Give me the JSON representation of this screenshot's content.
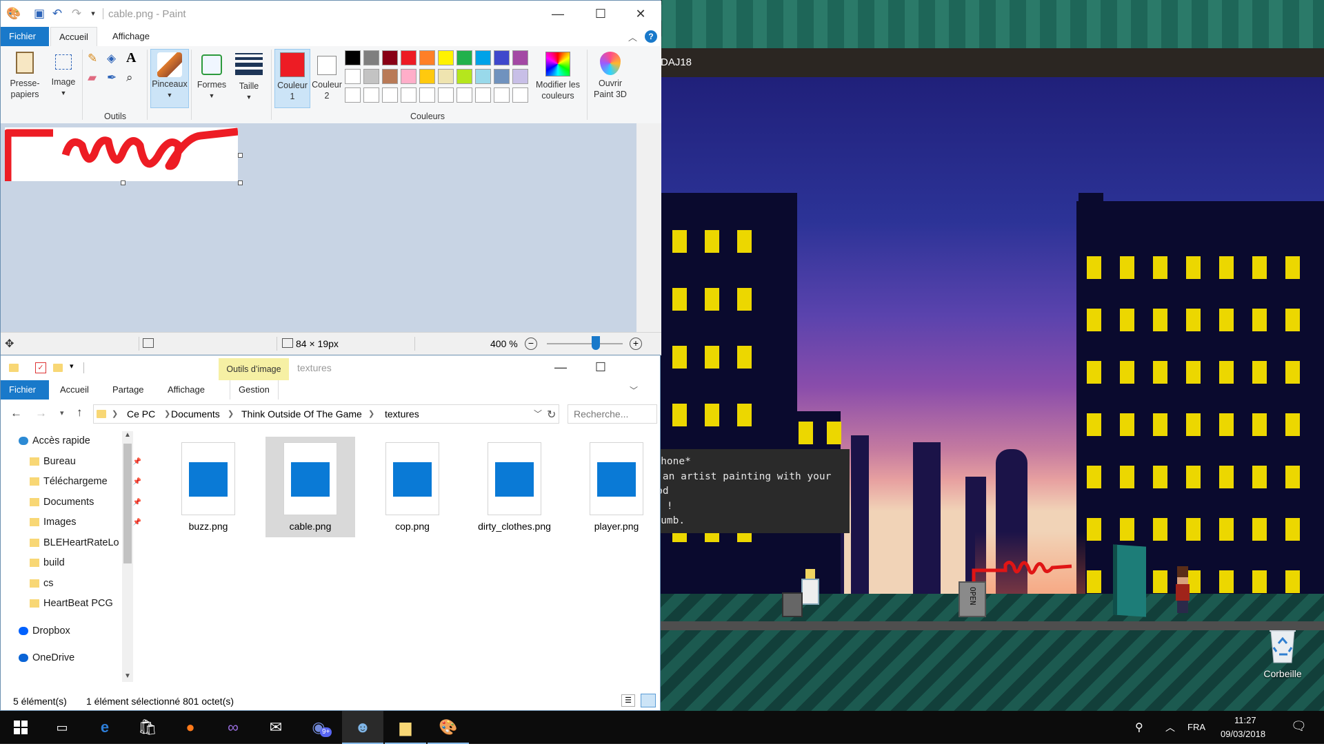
{
  "paint": {
    "title": "cable.png - Paint",
    "tabs": [
      "Fichier",
      "Accueil",
      "Affichage"
    ],
    "groups": {
      "clipboard": "Presse-\npapiers",
      "image": "Image",
      "tools_label": "Outils",
      "brushes": "Pinceaux",
      "shapes": "Formes",
      "size": "Taille",
      "color1": "Couleur\n1",
      "color2": "Couleur\n2",
      "colors_label": "Couleurs",
      "edit_colors": "Modifier les\ncouleurs",
      "paint3d": "Ouvrir\nPaint 3D"
    },
    "palette": [
      "#000000",
      "#7f7f7f",
      "#880015",
      "#ed1c24",
      "#ff7f27",
      "#fff200",
      "#22b14c",
      "#00a2e8",
      "#3f48cc",
      "#a349a4",
      "#ffffff",
      "#c3c3c3",
      "#b97a57",
      "#ffaec9",
      "#ffc90e",
      "#efe4b0",
      "#b5e61d",
      "#99d9ea",
      "#7092be",
      "#c8bfe7",
      "#ffffff",
      "#ffffff",
      "#ffffff",
      "#ffffff",
      "#ffffff",
      "#ffffff",
      "#ffffff",
      "#ffffff",
      "#ffffff",
      "#ffffff"
    ],
    "color1": "#ed1c24",
    "color2": "#ffffff",
    "status": {
      "dimensions": "84 × 19px",
      "zoom": "400 %"
    }
  },
  "game": {
    "title": "DAJ18",
    "dialog_lines": [
      "n Phone*",
      "ome an artist painting with your blood",
      "mao !",
      "duuumb."
    ],
    "open_sign": "OPEN"
  },
  "explorer": {
    "context_tab": "Outils d’image",
    "title": "textures",
    "tabs": [
      "Fichier",
      "Accueil",
      "Partage",
      "Affichage",
      "Gestion"
    ],
    "breadcrumb": [
      "Ce PC",
      "Documents",
      "Think Outside Of The Game",
      "textures"
    ],
    "search_placeholder": "Recherche...",
    "nav": [
      {
        "label": "Accès rapide",
        "type": "star"
      },
      {
        "label": "Bureau",
        "type": "folder-blue",
        "pinned": true
      },
      {
        "label": "Téléchargeme",
        "type": "download",
        "pinned": true
      },
      {
        "label": "Documents",
        "type": "doc",
        "pinned": true
      },
      {
        "label": "Images",
        "type": "pic",
        "pinned": true
      },
      {
        "label": "BLEHeartRateLo",
        "type": "folder"
      },
      {
        "label": "build",
        "type": "folder"
      },
      {
        "label": "cs",
        "type": "folder"
      },
      {
        "label": "HeartBeat PCG",
        "type": "folder"
      },
      {
        "label": "Dropbox",
        "type": "dropbox"
      },
      {
        "label": "OneDrive",
        "type": "cloud"
      }
    ],
    "files": [
      {
        "name": "buzz.png",
        "selected": false
      },
      {
        "name": "cable.png",
        "selected": true
      },
      {
        "name": "cop.png",
        "selected": false
      },
      {
        "name": "dirty_clothes.png",
        "selected": false
      },
      {
        "name": "player.png",
        "selected": false
      }
    ],
    "status": {
      "count": "5 élément(s)",
      "selection": "1 élément sélectionné  801 octet(s)"
    }
  },
  "desktop": {
    "recycle_bin": "Corbeille"
  },
  "taskbar": {
    "language": "FRA",
    "time": "11:27",
    "date": "09/03/2018",
    "mail_badge": "9+"
  }
}
